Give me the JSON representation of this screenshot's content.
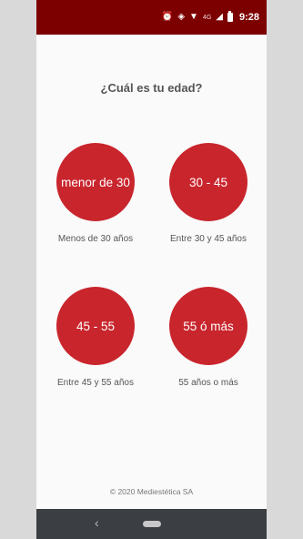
{
  "status_bar": {
    "icons": [
      "alarm-icon",
      "vibrate-icon",
      "wifi-icon",
      "lte-signal-icon",
      "battery-icon"
    ],
    "network": "4G",
    "time": "9:28"
  },
  "colors": {
    "status_bar": "#7d0000",
    "accent": "#c9252d",
    "background": "#fafafa",
    "nav_bar": "#3b3e42"
  },
  "question": "¿Cuál es tu edad?",
  "options": [
    {
      "label": "menor de 30",
      "caption": "Menos de 30 años"
    },
    {
      "label": "30 - 45",
      "caption": "Entre 30 y 45 años"
    },
    {
      "label": "45 - 55",
      "caption": "Entre 45 y 55 años"
    },
    {
      "label": "55 ó más",
      "caption": "55 años o más"
    }
  ],
  "footer": "© 2020 Mediestética SA"
}
